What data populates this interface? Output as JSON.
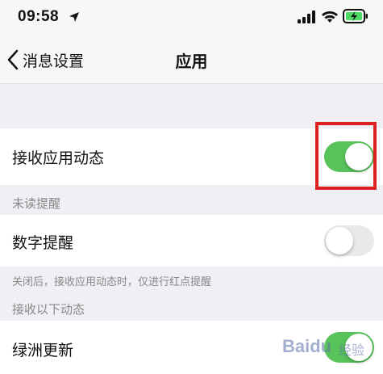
{
  "status_bar": {
    "time": "09:58"
  },
  "nav": {
    "back_label": "消息设置",
    "title": "应用"
  },
  "rows": {
    "receive_app_updates": {
      "label": "接收应用动态",
      "toggle_on": true
    },
    "digit_reminder": {
      "label": "数字提醒",
      "toggle_on": false
    },
    "oasis_updates": {
      "label": "绿洲更新",
      "toggle_on": true
    }
  },
  "sections": {
    "unread_header": "未读提醒",
    "unread_footer": "关闭后，接收应用动态时，仅进行红点提醒",
    "receive_header": "接收以下动态"
  },
  "watermark": {
    "brand": "Baidu",
    "sub": "经验"
  },
  "colors": {
    "toggle_on": "#58c35a",
    "toggle_off": "#e9e9eb",
    "highlight": "#e02020"
  }
}
